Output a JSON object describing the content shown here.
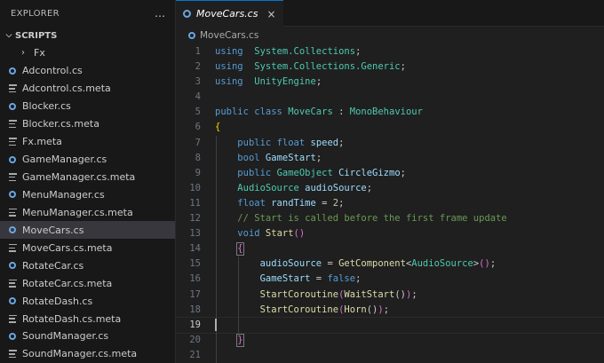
{
  "explorer": {
    "title": "EXPLORER",
    "more_icon": "…",
    "section": "SCRIPTS",
    "folder": "Fx",
    "files": [
      {
        "name": "Adcontrol.cs",
        "icon": "csharp-icon"
      },
      {
        "name": "Adcontrol.cs.meta",
        "icon": "meta-file-icon"
      },
      {
        "name": "Blocker.cs",
        "icon": "csharp-icon"
      },
      {
        "name": "Blocker.cs.meta",
        "icon": "meta-file-icon"
      },
      {
        "name": "Fx.meta",
        "icon": "meta-file-icon"
      },
      {
        "name": "GameManager.cs",
        "icon": "csharp-icon"
      },
      {
        "name": "GameManager.cs.meta",
        "icon": "meta-file-icon"
      },
      {
        "name": "MenuManager.cs",
        "icon": "csharp-icon"
      },
      {
        "name": "MenuManager.cs.meta",
        "icon": "meta-file-icon"
      },
      {
        "name": "MoveCars.cs",
        "icon": "csharp-icon",
        "active": true
      },
      {
        "name": "MoveCars.cs.meta",
        "icon": "meta-file-icon"
      },
      {
        "name": "RotateCar.cs",
        "icon": "csharp-icon"
      },
      {
        "name": "RotateCar.cs.meta",
        "icon": "meta-file-icon"
      },
      {
        "name": "RotateDash.cs",
        "icon": "csharp-icon"
      },
      {
        "name": "RotateDash.cs.meta",
        "icon": "meta-file-icon"
      },
      {
        "name": "SoundManager.cs",
        "icon": "csharp-icon"
      },
      {
        "name": "SoundManager.cs.meta",
        "icon": "meta-file-icon"
      }
    ]
  },
  "editor": {
    "tab_label": "MoveCars.cs",
    "close_icon": "×",
    "breadcrumb": "MoveCars.cs",
    "current_line": 19,
    "lines": [
      {
        "n": "1",
        "tokens": [
          [
            "kw",
            "using"
          ],
          [
            "",
            "  "
          ],
          [
            "ty",
            "System.Collections"
          ],
          [
            "",
            ";"
          ]
        ]
      },
      {
        "n": "2",
        "tokens": [
          [
            "kw",
            "using"
          ],
          [
            "",
            "  "
          ],
          [
            "ty",
            "System.Collections.Generic"
          ],
          [
            "",
            ";"
          ]
        ]
      },
      {
        "n": "3",
        "tokens": [
          [
            "kw",
            "using"
          ],
          [
            "",
            "  "
          ],
          [
            "ty",
            "UnityEngine"
          ],
          [
            "",
            ";"
          ]
        ]
      },
      {
        "n": "4",
        "tokens": []
      },
      {
        "n": "5",
        "tokens": [
          [
            "kw",
            "public"
          ],
          [
            "",
            " "
          ],
          [
            "kw",
            "class"
          ],
          [
            "",
            " "
          ],
          [
            "ty",
            "MoveCars"
          ],
          [
            "",
            " : "
          ],
          [
            "ty",
            "MonoBehaviour"
          ]
        ]
      },
      {
        "n": "6",
        "tokens": [
          [
            "br1",
            "{"
          ]
        ]
      },
      {
        "n": "7",
        "tokens": [
          [
            "",
            "    "
          ],
          [
            "kw",
            "public"
          ],
          [
            "",
            " "
          ],
          [
            "kw",
            "float"
          ],
          [
            "",
            " "
          ],
          [
            "id",
            "speed"
          ],
          [
            "",
            ";"
          ]
        ]
      },
      {
        "n": "8",
        "tokens": [
          [
            "",
            "    "
          ],
          [
            "kw",
            "bool"
          ],
          [
            "",
            " "
          ],
          [
            "id",
            "GameStart"
          ],
          [
            "",
            ";"
          ]
        ]
      },
      {
        "n": "9",
        "tokens": [
          [
            "",
            "    "
          ],
          [
            "kw",
            "public"
          ],
          [
            "",
            " "
          ],
          [
            "ty",
            "GameObject"
          ],
          [
            "",
            " "
          ],
          [
            "id",
            "CircleGizmo"
          ],
          [
            "",
            ";"
          ]
        ]
      },
      {
        "n": "10",
        "tokens": [
          [
            "",
            "    "
          ],
          [
            "ty",
            "AudioSource"
          ],
          [
            "",
            " "
          ],
          [
            "id",
            "audioSource"
          ],
          [
            "",
            ";"
          ]
        ]
      },
      {
        "n": "11",
        "tokens": [
          [
            "",
            "    "
          ],
          [
            "kw",
            "float"
          ],
          [
            "",
            " "
          ],
          [
            "id",
            "randTime"
          ],
          [
            "",
            " = "
          ],
          [
            "nm",
            "2"
          ],
          [
            "",
            ";"
          ]
        ]
      },
      {
        "n": "12",
        "tokens": [
          [
            "",
            "    "
          ],
          [
            "cm",
            "// Start is called before the first frame update"
          ]
        ]
      },
      {
        "n": "13",
        "tokens": [
          [
            "",
            "    "
          ],
          [
            "kw",
            "void"
          ],
          [
            "",
            " "
          ],
          [
            "fn",
            "Start"
          ],
          [
            "br2",
            "()"
          ]
        ]
      },
      {
        "n": "14",
        "tokens": [
          [
            "",
            "    "
          ],
          [
            "br2",
            "{"
          ]
        ]
      },
      {
        "n": "15",
        "tokens": [
          [
            "",
            "        "
          ],
          [
            "id",
            "audioSource"
          ],
          [
            "",
            " = "
          ],
          [
            "fn",
            "GetComponent"
          ],
          [
            "",
            "<"
          ],
          [
            "ty",
            "AudioSource"
          ],
          [
            "",
            ">"
          ],
          [
            "br2",
            "()"
          ],
          [
            "",
            ";"
          ]
        ]
      },
      {
        "n": "16",
        "tokens": [
          [
            "",
            "        "
          ],
          [
            "id",
            "GameStart"
          ],
          [
            "",
            " = "
          ],
          [
            "kw",
            "false"
          ],
          [
            "",
            ";"
          ]
        ]
      },
      {
        "n": "17",
        "tokens": [
          [
            "",
            "        "
          ],
          [
            "fn",
            "StartCoroutine"
          ],
          [
            "br2",
            "("
          ],
          [
            "fn",
            "WaitStart"
          ],
          [
            "",
            "()"
          ],
          [
            "br2",
            ")"
          ],
          [
            "",
            ";"
          ]
        ]
      },
      {
        "n": "18",
        "tokens": [
          [
            "",
            "        "
          ],
          [
            "fn",
            "StartCoroutine"
          ],
          [
            "br2",
            "("
          ],
          [
            "fn",
            "Horn"
          ],
          [
            "",
            "()"
          ],
          [
            "br2",
            ")"
          ],
          [
            "",
            ";"
          ]
        ]
      },
      {
        "n": "19",
        "tokens": []
      },
      {
        "n": "20",
        "tokens": [
          [
            "",
            "    "
          ],
          [
            "br2",
            "}"
          ]
        ]
      },
      {
        "n": "21",
        "tokens": []
      }
    ]
  },
  "colors": {
    "accent": "#0078d4",
    "active_item": "#37373d",
    "csharp_icon": "#6aa6e0"
  }
}
